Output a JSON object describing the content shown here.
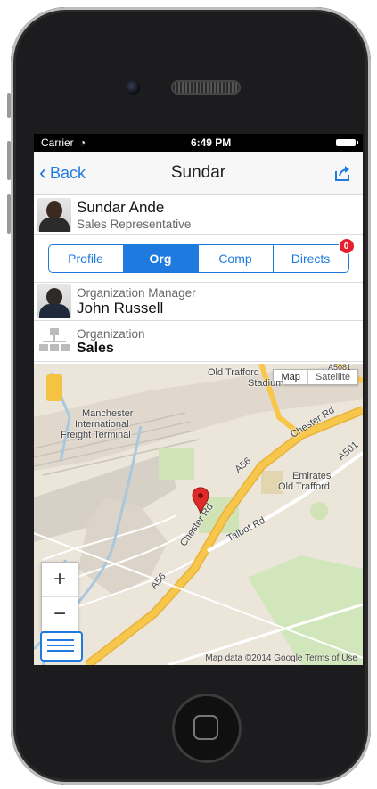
{
  "status": {
    "carrier": "Carrier",
    "time": "6:49 PM"
  },
  "nav": {
    "back_label": "Back",
    "title": "Sundar"
  },
  "person": {
    "name": "Sundar Ande",
    "title": "Sales Representative"
  },
  "tabs": [
    {
      "label": "Profile"
    },
    {
      "label": "Org",
      "active": true
    },
    {
      "label": "Comp"
    },
    {
      "label": "Directs",
      "badge": "0"
    }
  ],
  "manager": {
    "label": "Organization Manager",
    "name": "John Russell"
  },
  "organization": {
    "label": "Organization",
    "name": "Sales"
  },
  "map": {
    "type_map": "Map",
    "type_satellite": "Satellite",
    "labels": {
      "old_trafford": "Old Trafford",
      "stadium": "Stadium",
      "a5081": "A5081",
      "manchester": "Manchester",
      "international": "International",
      "freight": "Freight Terminal",
      "chester_rd": "Chester Rd",
      "chester_rd_2": "Chester Rd",
      "a56_top": "A56",
      "a56_bottom": "A56",
      "emirates": "Emirates",
      "emirates_2": "Old Trafford",
      "talbot": "Talbot Rd",
      "a501": "A501"
    },
    "zoom_in": "+",
    "zoom_out": "−",
    "attribution": "Map data ©2014 Google   Terms of Use"
  },
  "colors": {
    "accent": "#1f7ae0",
    "badge": "#e5202e",
    "road_major": "#f6c74b"
  }
}
